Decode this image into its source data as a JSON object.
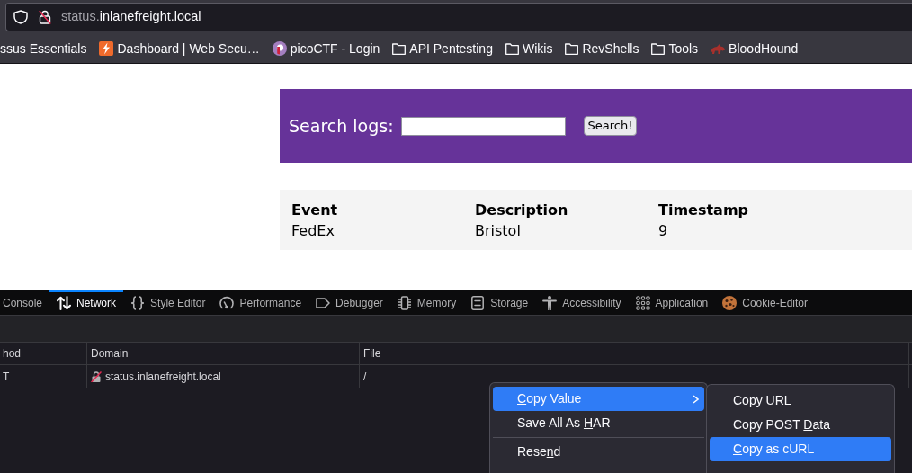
{
  "browser": {
    "url": {
      "subdomain": "status.",
      "domain": "inlanefreight.local"
    },
    "bookmarks": [
      {
        "kind": "bare",
        "label": "ssus Essentials"
      },
      {
        "kind": "bolt",
        "label": "Dashboard | Web Secu…"
      },
      {
        "kind": "disc",
        "label": "picoCTF - Login"
      },
      {
        "kind": "folder",
        "label": "API Pentesting"
      },
      {
        "kind": "folder",
        "label": "Wikis"
      },
      {
        "kind": "folder",
        "label": "RevShells"
      },
      {
        "kind": "folder",
        "label": "Tools"
      },
      {
        "kind": "dog",
        "label": "BloodHound"
      }
    ]
  },
  "page": {
    "search": {
      "label": "Search logs:",
      "button": "Search!"
    },
    "table": {
      "columns": [
        "Event",
        "Description",
        "Timestamp"
      ],
      "rows": [
        [
          "FedEx",
          "Bristol",
          "9"
        ]
      ]
    }
  },
  "devtools": {
    "tabs": [
      {
        "label": "Console",
        "selected": false
      },
      {
        "label": "Network",
        "selected": true
      },
      {
        "label": "Style Editor",
        "selected": false
      },
      {
        "label": "Performance",
        "selected": false
      },
      {
        "label": "Debugger",
        "selected": false
      },
      {
        "label": "Memory",
        "selected": false
      },
      {
        "label": "Storage",
        "selected": false
      },
      {
        "label": "Accessibility",
        "selected": false
      },
      {
        "label": "Application",
        "selected": false
      },
      {
        "label": "Cookie-Editor",
        "selected": false
      }
    ],
    "network": {
      "columns": [
        "hod",
        "Domain",
        "File"
      ],
      "rows": [
        {
          "method": "T",
          "domain": "status.inlanefreight.local",
          "file": "/"
        }
      ]
    },
    "context_menu": {
      "items": [
        {
          "kind": "item",
          "label": [
            {
              "text": "C",
              "underline": true
            },
            {
              "text": "opy Value",
              "underline": false
            }
          ],
          "submenu": true,
          "selected": true
        },
        {
          "kind": "item",
          "label": [
            {
              "text": "Save All As ",
              "underline": false
            },
            {
              "text": "H",
              "underline": true
            },
            {
              "text": "AR",
              "underline": false
            }
          ],
          "submenu": false,
          "selected": false
        },
        {
          "kind": "separator"
        },
        {
          "kind": "item",
          "label": [
            {
              "text": "Rese",
              "underline": false
            },
            {
              "text": "n",
              "underline": true
            },
            {
              "text": "d",
              "underline": false
            }
          ],
          "submenu": false,
          "selected": false
        }
      ]
    },
    "submenu": {
      "items": [
        {
          "label": [
            {
              "text": "Copy ",
              "underline": false
            },
            {
              "text": "U",
              "underline": true
            },
            {
              "text": "RL",
              "underline": false
            }
          ],
          "selected": false
        },
        {
          "label": [
            {
              "text": "Copy POST ",
              "underline": false
            },
            {
              "text": "D",
              "underline": true
            },
            {
              "text": "ata",
              "underline": false
            }
          ],
          "selected": false
        },
        {
          "label": [
            {
              "text": "C",
              "underline": true
            },
            {
              "text": "opy as cURL",
              "underline": false
            }
          ],
          "selected": true
        }
      ]
    }
  }
}
